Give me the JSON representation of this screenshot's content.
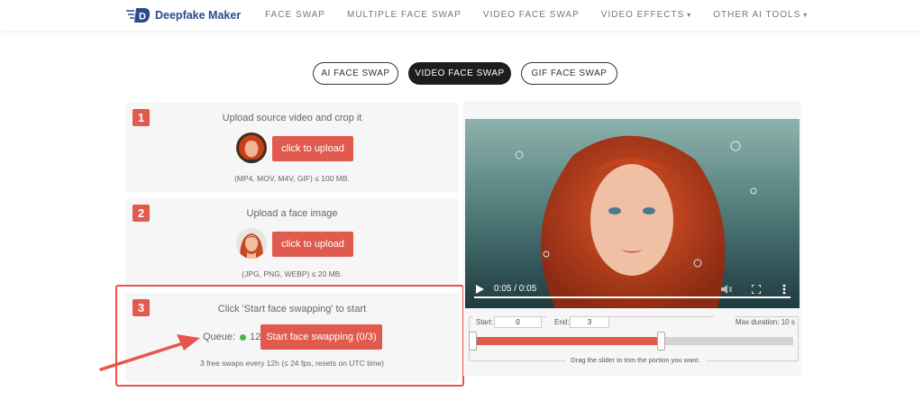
{
  "header": {
    "logo_text": "Deepfake Maker",
    "nav": [
      {
        "label": "FACE SWAP",
        "dropdown": false
      },
      {
        "label": "MULTIPLE FACE SWAP",
        "dropdown": false
      },
      {
        "label": "VIDEO FACE SWAP",
        "dropdown": false
      },
      {
        "label": "VIDEO EFFECTS",
        "dropdown": true
      },
      {
        "label": "OTHER AI TOOLS",
        "dropdown": true
      }
    ]
  },
  "tabs": [
    {
      "label": "AI FACE SWAP",
      "active": false
    },
    {
      "label": "VIDEO FACE SWAP",
      "active": true
    },
    {
      "label": "GIF FACE SWAP",
      "active": false
    }
  ],
  "steps": {
    "step1": {
      "number": "1",
      "title": "Upload source video and crop it",
      "button": "click to upload",
      "hint": "(MP4, MOV, M4V, GIF) ≤ 100 MB."
    },
    "step2": {
      "number": "2",
      "title": "Upload a face image",
      "button": "click to upload",
      "hint": "(JPG, PNG, WEBP) ≤ 20 MB."
    },
    "step3": {
      "number": "3",
      "title": "Click 'Start face swapping' to start",
      "queue_label": "Queue:",
      "queue_count": "12",
      "button": "Start face swapping (0/3)",
      "hint": "3 free swaps every 12h (≤ 24 fps, resets on UTC time)"
    }
  },
  "video": {
    "time": "0:05 / 0:05",
    "progress_fraction": 1.0
  },
  "trim": {
    "start_label": "Start:",
    "start_value": "0",
    "end_label": "End:",
    "end_value": "3",
    "max_duration": "Max duration: 10 s",
    "selected_fraction": 0.585,
    "caption": "Drag the slider to trim the portion you want."
  },
  "colors": {
    "accent": "#e05a4e",
    "queue_dot": "#4cb548",
    "arrow": "#e8554a"
  }
}
